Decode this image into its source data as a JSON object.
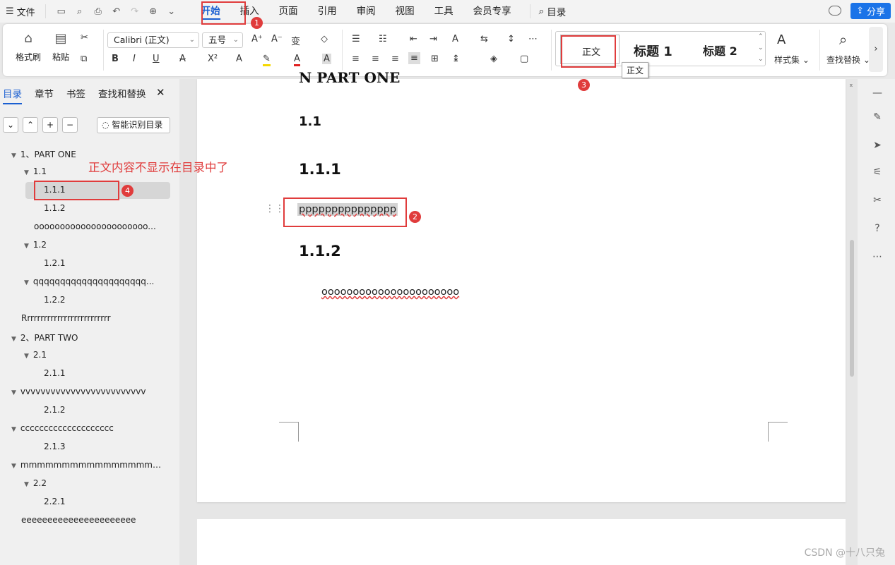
{
  "menubar": {
    "file_label": "文件",
    "tabs": [
      "开始",
      "插入",
      "页面",
      "引用",
      "审阅",
      "视图",
      "工具",
      "会员专享"
    ],
    "search_label": "目录",
    "share_label": "分享"
  },
  "ribbon": {
    "format_painter": "格式刷",
    "paste": "粘贴",
    "font_name": "Calibri (正文)",
    "font_size": "五号",
    "styles": {
      "normal": "正文",
      "heading1": "标题 1",
      "heading2": "标题 2"
    },
    "style_set": "样式集",
    "find_replace": "查找替换",
    "tooltip": "正文"
  },
  "sidebar": {
    "tabs": [
      "目录",
      "章节",
      "书签",
      "查找和替换"
    ],
    "smart_button": "智能识别目录",
    "toc": [
      {
        "text": "1、PART ONE",
        "level": 0,
        "tri": true
      },
      {
        "text": "1.1",
        "level": 1,
        "tri": true
      },
      {
        "text": "1.1.1",
        "level": 2,
        "tri": false
      },
      {
        "text": "1.1.2",
        "level": 2,
        "tri": false
      },
      {
        "text": "oooooooooooooooooooooo...",
        "level": 1,
        "tri": false
      },
      {
        "text": "1.2",
        "level": 1,
        "tri": true
      },
      {
        "text": "1.2.1",
        "level": 2,
        "tri": false
      },
      {
        "text": "qqqqqqqqqqqqqqqqqqqqq...",
        "level": 1,
        "tri": true
      },
      {
        "text": "1.2.2",
        "level": 2,
        "tri": false
      },
      {
        "text": "Rrrrrrrrrrrrrrrrrrrrrrrrrr",
        "level": 0,
        "tri": false
      },
      {
        "text": "2、PART TWO",
        "level": 0,
        "tri": true
      },
      {
        "text": "2.1",
        "level": 1,
        "tri": true
      },
      {
        "text": "2.1.1",
        "level": 2,
        "tri": false
      },
      {
        "text": "vvvvvvvvvvvvvvvvvvvvvvvvv",
        "level": 0,
        "tri": true
      },
      {
        "text": "2.1.2",
        "level": 2,
        "tri": false
      },
      {
        "text": "cccccccccccccccccccc",
        "level": 0,
        "tri": true
      },
      {
        "text": "2.1.3",
        "level": 2,
        "tri": false
      },
      {
        "text": "mmmmmmmmmmmmmmmmm...",
        "level": 0,
        "tri": true
      },
      {
        "text": "2.2",
        "level": 1,
        "tri": true
      },
      {
        "text": "2.2.1",
        "level": 2,
        "tri": false
      },
      {
        "text": "eeeeeeeeeeeeeeeeeeeeee",
        "level": 0,
        "tri": false
      }
    ]
  },
  "annotation": {
    "text": "正文内容不显示在目录中了",
    "badges": [
      "1",
      "2",
      "3",
      "4"
    ]
  },
  "document": {
    "top_partial": "N PART ONE",
    "h_1_1": "1.1",
    "h_1_1_1": "1.1.1",
    "body_p": "ppppppppppppppp",
    "h_1_1_2": "1.1.2",
    "body_o": "oooooooooooooooooooooo"
  },
  "watermark": "CSDN @十八只兔"
}
